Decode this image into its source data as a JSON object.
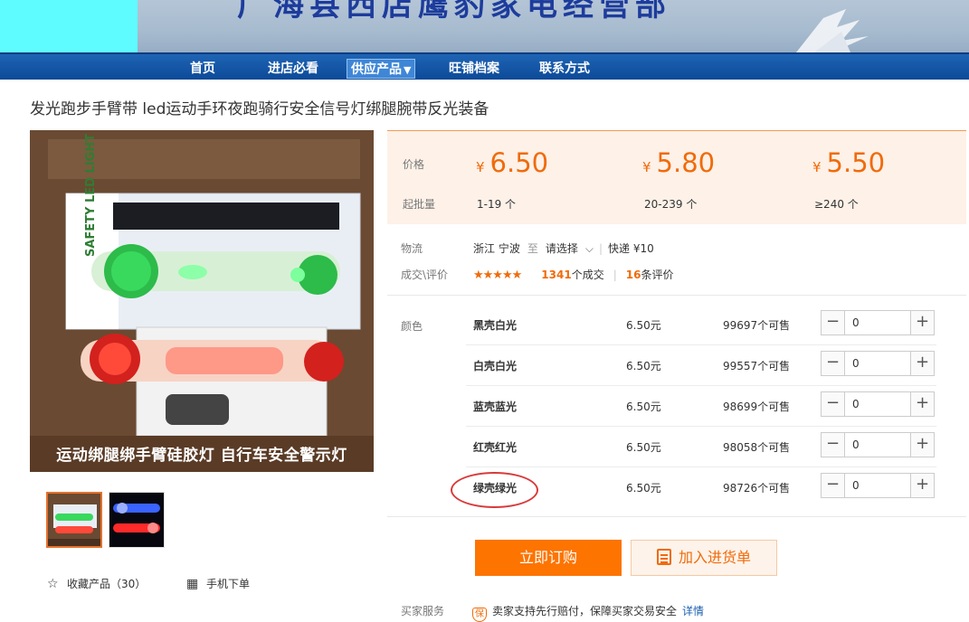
{
  "banner": {
    "shop_name": "广海县西店鹰豹家电经营部"
  },
  "nav": {
    "items": [
      {
        "label": "首页"
      },
      {
        "label": "进店必看"
      },
      {
        "label": "供应产品",
        "active": true
      },
      {
        "label": "旺铺档案"
      },
      {
        "label": "联系方式"
      }
    ],
    "dropdown_glyph": "▼"
  },
  "product": {
    "title": "发光跑步手臂带 led运动手环夜跑骑行安全信号灯绑腿腕带反光装备",
    "image_caption": "运动绑腿绑手臂硅胶灯 自行车安全警示灯",
    "package_text": "SAFETY LED LIGHT"
  },
  "actions": {
    "favorite_label": "收藏产品（30）",
    "mobile_label": "手机下单",
    "favorite_icon": "star-outline-icon",
    "mobile_icon": "qrcode-icon"
  },
  "pricing": {
    "price_label": "价格",
    "moq_label": "起批量",
    "currency": "¥",
    "tiers": [
      {
        "price": "6.50",
        "qty": "1-19 个"
      },
      {
        "price": "5.80",
        "qty": "20-239 个"
      },
      {
        "price": "5.50",
        "qty": "≥240 个"
      }
    ],
    "accent_color": "#f06b0a"
  },
  "logistics": {
    "label": "物流",
    "from": "浙江 宁波",
    "to_word": "至",
    "destination": "请选择",
    "express": "快递 ¥10"
  },
  "reviews": {
    "label": "成交\\评价",
    "stars": "★★★★★",
    "deals_count": "1341",
    "deals_suffix": "个成交",
    "review_count": "16",
    "review_suffix": "条评价"
  },
  "sku": {
    "label": "颜色",
    "rows": [
      {
        "name": "黑壳白光",
        "price": "6.50元",
        "stock": "99697个可售",
        "qty": "0"
      },
      {
        "name": "白壳白光",
        "price": "6.50元",
        "stock": "99557个可售",
        "qty": "0"
      },
      {
        "name": "蓝壳蓝光",
        "price": "6.50元",
        "stock": "98699个可售",
        "qty": "0"
      },
      {
        "name": "红壳红光",
        "price": "6.50元",
        "stock": "98058个可售",
        "qty": "0"
      },
      {
        "name": "绿壳绿光",
        "price": "6.50元",
        "stock": "98726个可售",
        "qty": "0"
      }
    ],
    "minus": "−",
    "plus": "+"
  },
  "buttons": {
    "buy_now": "立即订购",
    "add_to_cart": "加入进货单"
  },
  "service": {
    "label": "买家服务",
    "shield_glyph": "保",
    "text": "卖家支持先行赔付，保障买家交易安全",
    "link": "详情"
  }
}
